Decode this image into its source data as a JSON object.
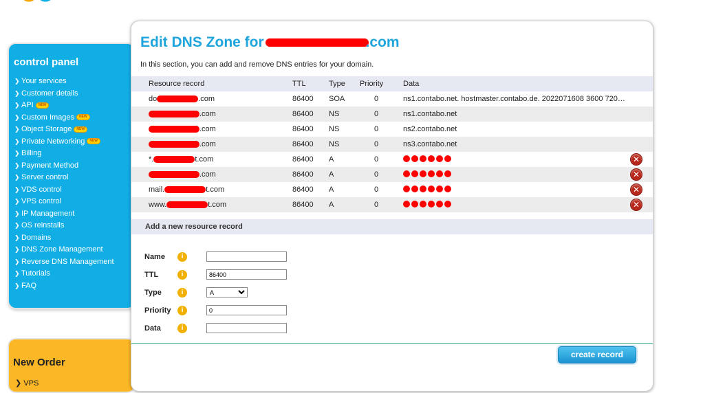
{
  "sidebar": {
    "title": "control panel",
    "items": [
      {
        "label": "Your services",
        "new": false
      },
      {
        "label": "Customer details",
        "new": false
      },
      {
        "label": "API",
        "new": true
      },
      {
        "label": "Custom Images",
        "new": true
      },
      {
        "label": "Object Storage",
        "new": true
      },
      {
        "label": "Private Networking",
        "new": true
      },
      {
        "label": "Billing",
        "new": false
      },
      {
        "label": "Payment Method",
        "new": false
      },
      {
        "label": "Server control",
        "new": false
      },
      {
        "label": "VDS control",
        "new": false
      },
      {
        "label": "VPS control",
        "new": false
      },
      {
        "label": "IP Management",
        "new": false
      },
      {
        "label": "OS reinstalls",
        "new": false
      },
      {
        "label": "Domains",
        "new": false
      },
      {
        "label": "DNS Zone Management",
        "new": false
      },
      {
        "label": "Reverse DNS Management",
        "new": false
      },
      {
        "label": "Tutorials",
        "new": false
      },
      {
        "label": "FAQ",
        "new": false
      }
    ],
    "new_badge": "NEW"
  },
  "neworder": {
    "title": "New Order",
    "first_item": "VPS"
  },
  "main": {
    "title_prefix": "Edit DNS Zone for ",
    "title_suffix": ".com",
    "intro": "In this section, you can add and remove DNS entries for your domain.",
    "columns": [
      "Resource record",
      "TTL",
      "Type",
      "Priority",
      "Data"
    ],
    "records": [
      {
        "name": "do",
        "name_suffix": ".com",
        "ttl": "86400",
        "type": "SOA",
        "priority": "0",
        "data": "ns1.contabo.net. hostmaster.contabo.de. 2022071608 3600 720…",
        "deletable": false
      },
      {
        "name": "",
        "name_suffix": ".com",
        "ttl": "86400",
        "type": "NS",
        "priority": "0",
        "data": "ns1.contabo.net",
        "deletable": false
      },
      {
        "name": "",
        "name_suffix": ".com",
        "ttl": "86400",
        "type": "NS",
        "priority": "0",
        "data": "ns2.contabo.net",
        "deletable": false
      },
      {
        "name": "",
        "name_suffix": ".com",
        "ttl": "86400",
        "type": "NS",
        "priority": "0",
        "data": "ns3.contabo.net",
        "deletable": false
      },
      {
        "name": "*.",
        "name_suffix": "t.com",
        "ttl": "86400",
        "type": "A",
        "priority": "0",
        "data": "",
        "deletable": true
      },
      {
        "name": "",
        "name_suffix": ".com",
        "ttl": "86400",
        "type": "A",
        "priority": "0",
        "data": "",
        "deletable": true
      },
      {
        "name": "mail.",
        "name_suffix": "t.com",
        "ttl": "86400",
        "type": "A",
        "priority": "0",
        "data": "",
        "deletable": true
      },
      {
        "name": "www.",
        "name_suffix": "t.com",
        "ttl": "86400",
        "type": "A",
        "priority": "0",
        "data": "",
        "deletable": true
      }
    ]
  },
  "add_form": {
    "header": "Add a new resource record",
    "name_label": "Name",
    "name_value": "",
    "ttl_label": "TTL",
    "ttl_value": "86400",
    "type_label": "Type",
    "type_value": "A",
    "priority_label": "Priority",
    "priority_value": "0",
    "data_label": "Data",
    "data_value": "",
    "submit_label": "create record",
    "info_glyph": "i"
  },
  "colors": {
    "accent": "#1ea5dd",
    "sidebar": "#11aee5",
    "neworder": "#fbb726",
    "delete": "#b8271b",
    "redaction": "#ff0000"
  }
}
